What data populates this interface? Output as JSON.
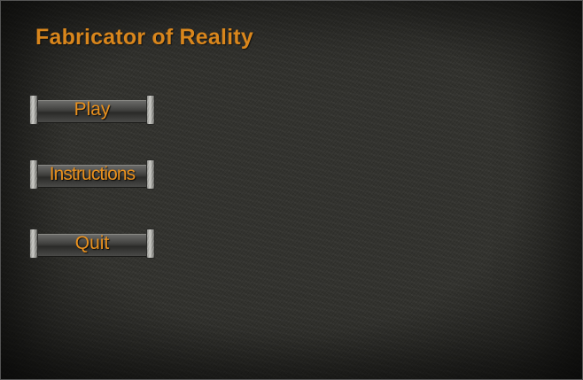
{
  "game": {
    "title": "Fabricator of Reality"
  },
  "menu": {
    "buttons": [
      {
        "label": "Play"
      },
      {
        "label": "Instructions"
      },
      {
        "label": "Quit"
      }
    ]
  },
  "colors": {
    "accent": "#e8901e",
    "background": "#33332f"
  }
}
